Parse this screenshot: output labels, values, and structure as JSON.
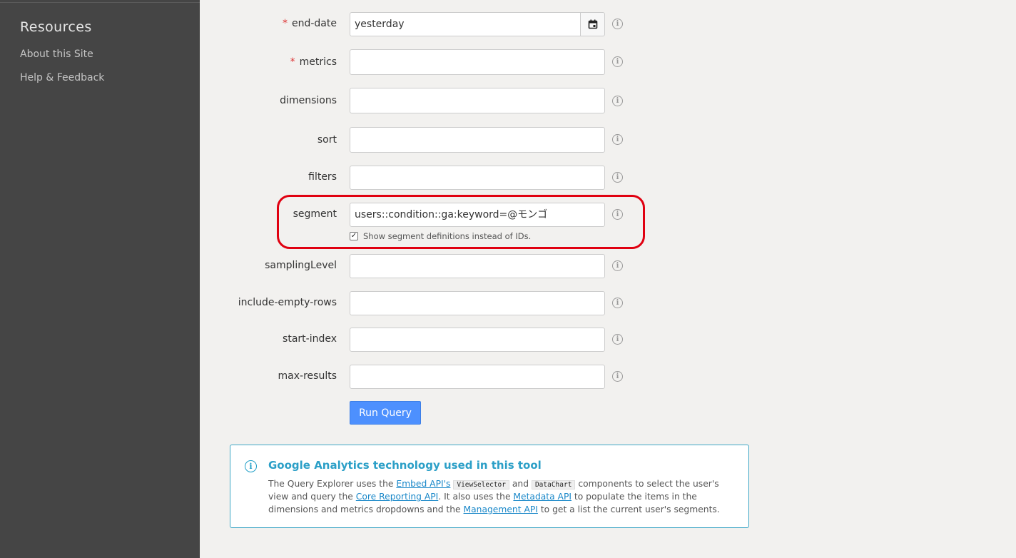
{
  "sidebar": {
    "title": "Resources",
    "links": [
      "About this Site",
      "Help & Feedback"
    ]
  },
  "form": {
    "end_date": {
      "label": "end-date",
      "required": true,
      "value": "yesterday"
    },
    "metrics": {
      "label": "metrics",
      "required": true,
      "value": ""
    },
    "dimensions": {
      "label": "dimensions",
      "value": ""
    },
    "sort": {
      "label": "sort",
      "value": ""
    },
    "filters": {
      "label": "filters",
      "value": ""
    },
    "segment": {
      "label": "segment",
      "value": "users::condition::ga:keyword=@モンゴ",
      "checkbox_label": "Show segment definitions instead of IDs.",
      "checkbox_checked": true
    },
    "samplingLevel": {
      "label": "samplingLevel",
      "value": ""
    },
    "include_empty_rows": {
      "label": "include-empty-rows",
      "value": ""
    },
    "start_index": {
      "label": "start-index",
      "value": ""
    },
    "max_results": {
      "label": "max-results",
      "value": ""
    },
    "required_marker": "*",
    "run_button": "Run Query"
  },
  "info_box": {
    "title": "Google Analytics technology used in this tool",
    "text_1": "The Query Explorer uses the ",
    "link_embed": "Embed API's",
    "code_1": "ViewSelector",
    "text_2": " and ",
    "code_2": "DataChart",
    "text_3": " components to select the user's view and query the ",
    "link_core": "Core Reporting API",
    "text_4": ". It also uses the ",
    "link_metadata": "Metadata API",
    "text_5": " to populate the items in the dimensions and metrics dropdowns and the ",
    "link_management": "Management API",
    "text_6": " to get a list the current user's segments."
  },
  "colors": {
    "sidebar_bg": "#454545",
    "page_bg": "#f2f1ef",
    "primary_button": "#4d90fe",
    "highlight_outline": "#e00010",
    "info_accent": "#2b9fc7"
  }
}
